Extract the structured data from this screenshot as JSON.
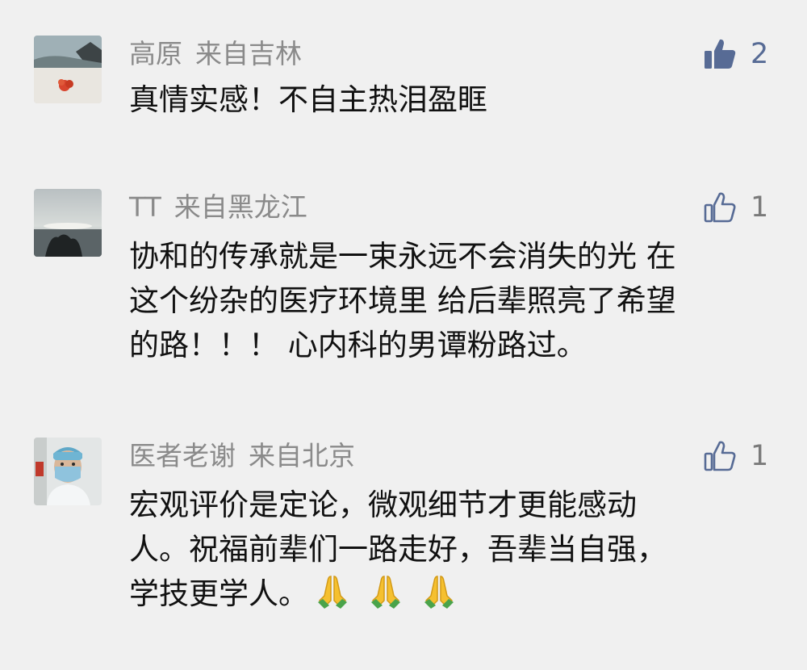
{
  "comments": [
    {
      "author": "高原",
      "location": "来自吉林",
      "likes": "2",
      "liked": true,
      "avatar": "beach-photo-avatar",
      "text": "真情实感！不自主热泪盈眶"
    },
    {
      "author": "TT",
      "location": "来自黑龙江",
      "likes": "1",
      "liked": false,
      "avatar": "sunset-sea-avatar",
      "lines": [
        "协和的传承就是一束永远不会消失的光 在",
        "这个纷杂的医疗环境里 给后辈照亮了希望",
        "的路！！！ 心内科的男谭粉路过。"
      ]
    },
    {
      "author": "医者老谢",
      "location": "来自北京",
      "likes": "1",
      "liked": false,
      "avatar": "doctor-mask-avatar",
      "lines": [
        "宏观评价是定论，微观细节才更能感动",
        "人。祝福前辈们一路走好，吾辈当自强，",
        "学技更学人。"
      ],
      "emoji": [
        "folded-hands-icon",
        "folded-hands-icon",
        "folded-hands-icon"
      ]
    }
  ],
  "colors": {
    "background": "#f0f0f0",
    "link_blue": "#576b95",
    "meta_gray": "#8a8a8a"
  }
}
